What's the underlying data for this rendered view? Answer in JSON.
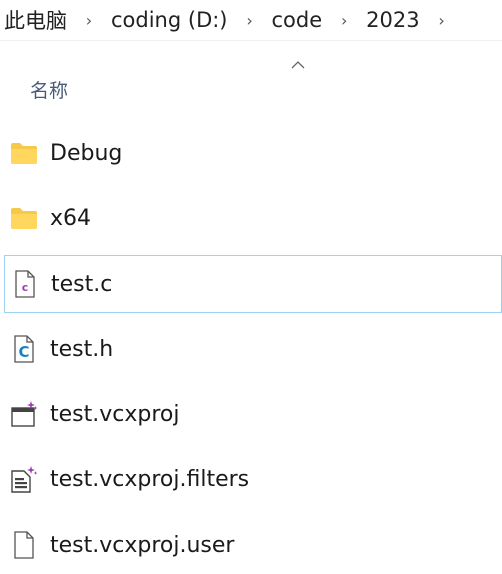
{
  "breadcrumb": {
    "items": [
      "此电脑",
      "coding (D:)",
      "code",
      "2023"
    ],
    "separator": "›"
  },
  "header": {
    "name_column": "名称"
  },
  "files": [
    {
      "name": "Debug",
      "icon": "folder-icon"
    },
    {
      "name": "x64",
      "icon": "folder-icon"
    },
    {
      "name": "test.c",
      "icon": "c-source-file-icon"
    },
    {
      "name": "test.h",
      "icon": "c-header-file-icon"
    },
    {
      "name": "test.vcxproj",
      "icon": "vcxproj-file-icon"
    },
    {
      "name": "test.vcxproj.filters",
      "icon": "vcxproj-filters-file-icon"
    },
    {
      "name": "test.vcxproj.user",
      "icon": "generic-file-icon"
    }
  ],
  "colors": {
    "folder": "#f7c948",
    "selection_border": "#9fd1f2",
    "c_source_accent": "#9b3fae",
    "c_header_accent": "#1f7fc2"
  }
}
